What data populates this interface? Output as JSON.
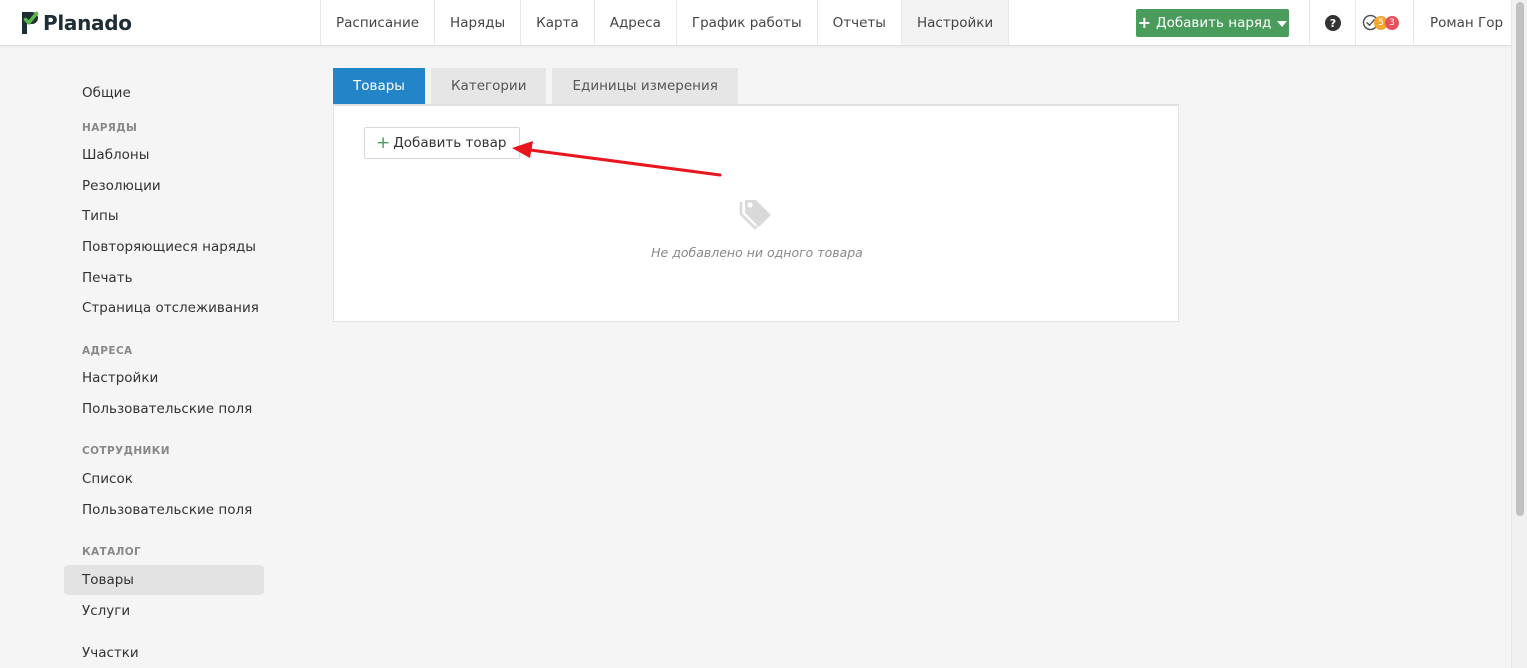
{
  "app": {
    "name": "Planado"
  },
  "nav": {
    "items": [
      {
        "label": "Расписание",
        "active": false
      },
      {
        "label": "Наряды",
        "active": false
      },
      {
        "label": "Карта",
        "active": false
      },
      {
        "label": "Адреса",
        "active": false
      },
      {
        "label": "График работы",
        "active": false
      },
      {
        "label": "Отчеты",
        "active": false
      },
      {
        "label": "Настройки",
        "active": true
      }
    ],
    "add_order_label": "Добавить наряд",
    "help_label": "?",
    "notifications": {
      "orange_count": "5",
      "red_count": "3"
    },
    "user_name": "Роман Гор"
  },
  "sidebar": {
    "general": "Общие",
    "orders_header": "НАРЯДЫ",
    "orders_items": [
      "Шаблоны",
      "Резолюции",
      "Типы",
      "Повторяющиеся наряды",
      "Печать",
      "Страница отслеживания"
    ],
    "addresses_header": "АДРЕСА",
    "addresses_items": [
      "Настройки",
      "Пользовательские поля"
    ],
    "staff_header": "СОТРУДНИКИ",
    "staff_items": [
      "Список",
      "Пользовательские поля"
    ],
    "catalog_header": "КАТАЛОГ",
    "catalog_items": [
      "Товары",
      "Услуги"
    ],
    "catalog_active": "Товары",
    "areas": "Участки"
  },
  "main": {
    "tabs": [
      {
        "label": "Товары",
        "active": true
      },
      {
        "label": "Категории",
        "active": false
      },
      {
        "label": "Единицы измерения",
        "active": false
      }
    ],
    "add_item_label": "Добавить товар",
    "empty_text": "Не добавлено ни одного товара"
  },
  "colors": {
    "accent_blue": "#2385c7",
    "accent_green": "#4a9c5d",
    "annotation_arrow": "#e8171f",
    "badge_orange": "#f0a830",
    "badge_red": "#e8505b"
  },
  "icons": {
    "logo": "planado-logo-icon",
    "help": "question-circle-icon",
    "notifications": "check-circle-icon",
    "empty_state": "tags-icon",
    "add": "plus-icon",
    "dropdown": "caret-down-icon"
  }
}
